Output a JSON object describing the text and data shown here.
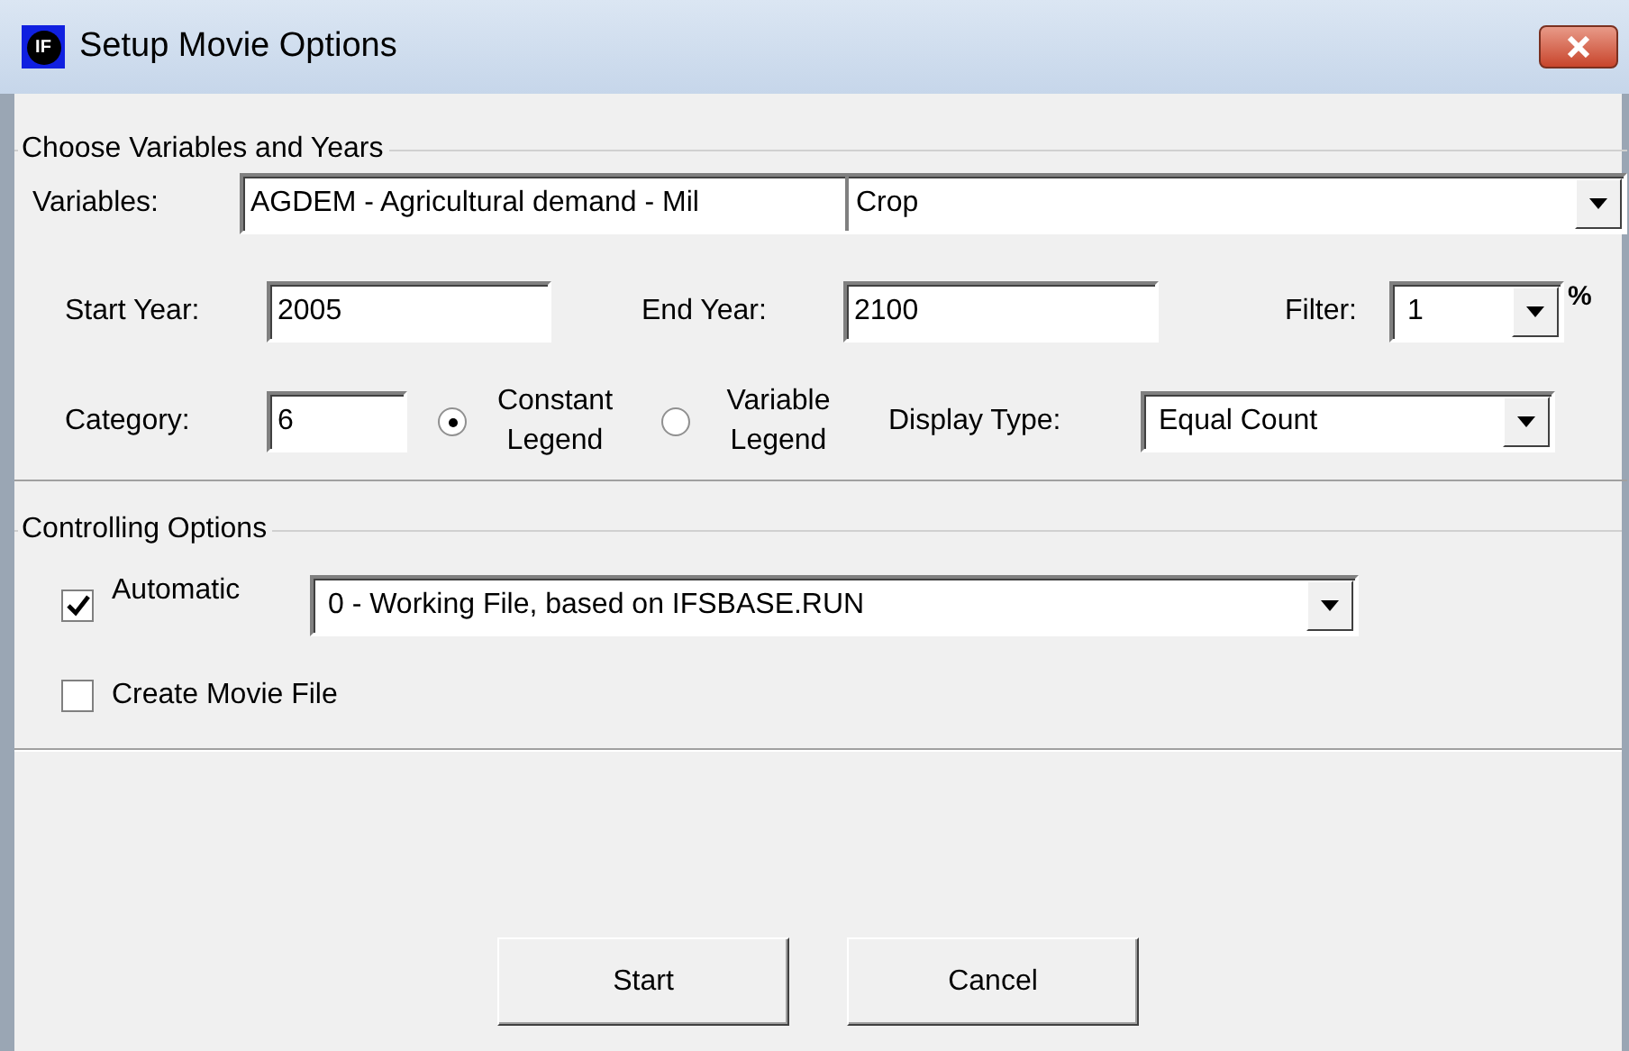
{
  "window": {
    "title": "Setup Movie Options",
    "icon_text": "IF"
  },
  "variables_group": {
    "title": "Choose Variables and Years",
    "variables": {
      "label": "Variables:",
      "code": "AGDEM - Agricultural demand - Mil",
      "value": "Crop"
    },
    "start_year": {
      "label": "Start Year:",
      "value": "2005"
    },
    "end_year": {
      "label": "End Year:",
      "value": "2100"
    },
    "filter": {
      "label": "Filter:",
      "value": "1",
      "unit": "%"
    },
    "category": {
      "label": "Category:",
      "value": "6"
    },
    "legend_options": [
      {
        "label": "Constant Legend",
        "selected": true
      },
      {
        "label": "Variable Legend",
        "selected": false
      }
    ],
    "display_type": {
      "label": "Display Type:",
      "value": "Equal Count"
    }
  },
  "controlling_group": {
    "title": "Controlling Options",
    "automatic": {
      "label": "Automatic",
      "checked": true,
      "value": "0 - Working File, based on IFSBASE.RUN"
    },
    "create_movie": {
      "label": "Create Movie File",
      "checked": false
    }
  },
  "buttons": [
    "Start",
    "Cancel"
  ]
}
